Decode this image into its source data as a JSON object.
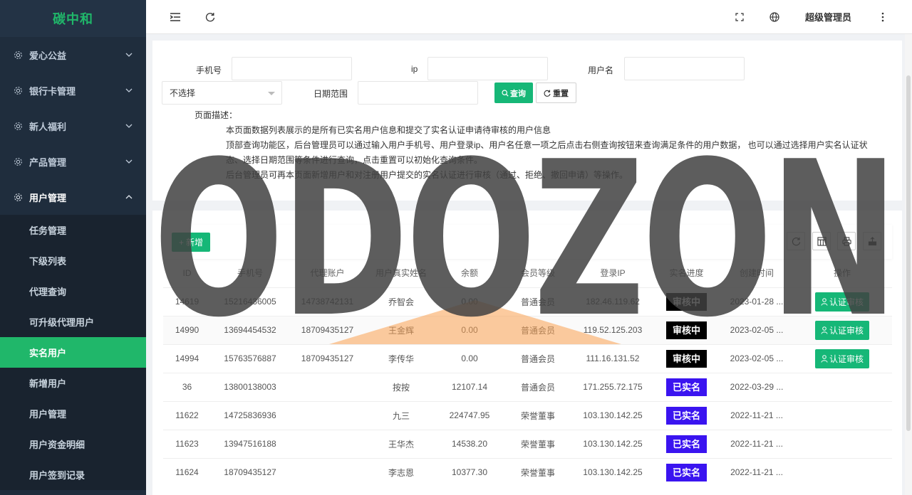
{
  "sidebar": {
    "logo": "碳中和",
    "menus": [
      {
        "label": "爱心公益"
      },
      {
        "label": "银行卡管理"
      },
      {
        "label": "新人福利"
      },
      {
        "label": "产品管理"
      },
      {
        "label": "用户管理"
      }
    ],
    "submenu": [
      {
        "label": "任务管理"
      },
      {
        "label": "下级列表"
      },
      {
        "label": "代理查询"
      },
      {
        "label": "可升级代理用户"
      },
      {
        "label": "实名用户",
        "active": true
      },
      {
        "label": "新增用户"
      },
      {
        "label": "用户管理"
      },
      {
        "label": "用户资金明细"
      },
      {
        "label": "用户签到记录"
      }
    ]
  },
  "topbar": {
    "admin_name": "超级管理员"
  },
  "filter": {
    "phone_label": "手机号",
    "ip_label": "ip",
    "username_label": "用户名",
    "select_value": "不选择",
    "date_label": "日期范围",
    "query_btn": "查询",
    "reset_btn": "重置"
  },
  "description": {
    "title": "页面描述：",
    "line1": "本页面数据列表展示的是所有已实名用户信息和提交了实名认证申请待审核的用户信息",
    "line2": "顶部查询功能区，后台管理员可以通过输入用户手机号、用户登录ip、用户名任意一项之后点击右侧查询按钮来查询满足条件的用户数据， 也可以通过选择用户实名认证状",
    "line3": "态、选择日期范围等条件进行查询，点击重置可以初始化查询条件。",
    "line4": "后台管理员可再本页面新增用户和对注册用户提交的实名认证进行审核（通过、拒绝、撤回申请）等操作。"
  },
  "toolbar": {
    "add_btn": "新增"
  },
  "table": {
    "headers": [
      "ID",
      "手机号",
      "代理账户",
      "用户真实姓名",
      "余额",
      "会员等级",
      "登录IP",
      "实名进度",
      "创建时间",
      "操作"
    ],
    "rows": [
      {
        "id": "14619",
        "phone": "15216436005",
        "agent": "14738742131",
        "name": "乔智会",
        "balance": "0.00",
        "level": "普通会员",
        "ip": "182.46.119.62",
        "status": "审核中",
        "created": "2023-01-28 ...",
        "action": "认证审核"
      },
      {
        "id": "14990",
        "phone": "13694454532",
        "agent": "18709435127",
        "name": "王金辉",
        "balance": "0.00",
        "level": "普通会员",
        "ip": "119.52.125.203",
        "status": "审核中",
        "created": "2023-02-05 ...",
        "action": "认证审核"
      },
      {
        "id": "14994",
        "phone": "15763576887",
        "agent": "18709435127",
        "name": "李传华",
        "balance": "0.00",
        "level": "普通会员",
        "ip": "111.16.131.52",
        "status": "审核中",
        "created": "2023-02-05 ...",
        "action": "认证审核"
      },
      {
        "id": "36",
        "phone": "13800138003",
        "agent": "",
        "name": "按按",
        "balance": "12107.14",
        "level": "普通会员",
        "ip": "171.255.72.175",
        "status": "已实名",
        "created": "2022-03-29 ...",
        "action": ""
      },
      {
        "id": "11622",
        "phone": "14725836936",
        "agent": "",
        "name": "九三",
        "balance": "224747.95",
        "level": "荣誉董事",
        "ip": "103.130.142.25",
        "status": "已实名",
        "created": "2022-11-21 ...",
        "action": ""
      },
      {
        "id": "11623",
        "phone": "13947516188",
        "agent": "",
        "name": "王华杰",
        "balance": "14538.20",
        "level": "荣誉董事",
        "ip": "103.130.142.25",
        "status": "已实名",
        "created": "2022-11-21 ...",
        "action": ""
      },
      {
        "id": "11624",
        "phone": "18709435127",
        "agent": "",
        "name": "李志恩",
        "balance": "10377.30",
        "level": "荣誉董事",
        "ip": "103.130.142.25",
        "status": "已实名",
        "created": "2022-11-21 ...",
        "action": ""
      }
    ]
  },
  "watermark": "ODOZON"
}
